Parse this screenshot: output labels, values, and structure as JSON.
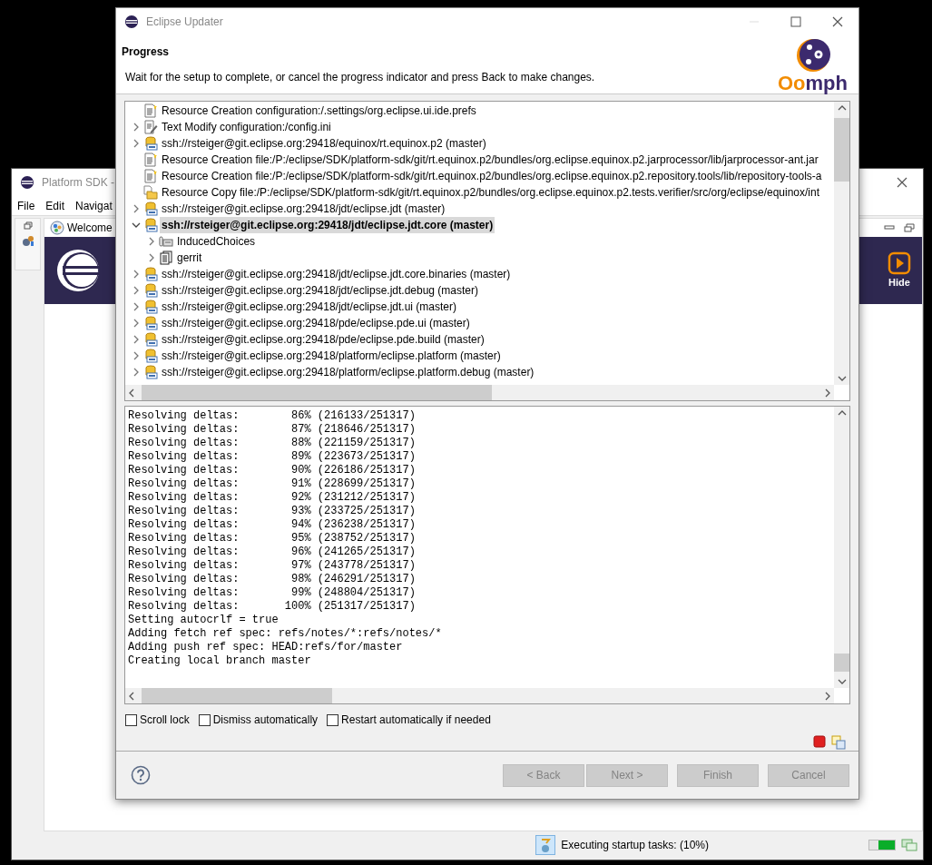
{
  "background_window": {
    "title": "Platform SDK -",
    "menu": [
      "File",
      "Edit",
      "Navigat"
    ],
    "editor_tab": {
      "label": "Welcome",
      "selected": true
    },
    "banner": {
      "hide_button": "Hide"
    },
    "status_bar": {
      "message": "Executing startup tasks: (10%)",
      "heap": {
        "level": 0.65
      }
    }
  },
  "dialog": {
    "title": "Eclipse Updater",
    "heading": "Progress",
    "description": "Wait for the setup to complete, or cancel the progress indicator and press Back to make changes.",
    "logo_text": "Oomph",
    "tasks": [
      {
        "kind": "creation",
        "selected": false,
        "label": "Resource Creation configuration:/.settings/org.eclipse.ui.ide.prefs"
      },
      {
        "kind": "modify",
        "expanded": false,
        "selected": false,
        "label": "Text Modify configuration:/config.ini"
      },
      {
        "kind": "git",
        "expanded": false,
        "selected": false,
        "label": "ssh://rsteiger@git.eclipse.org:29418/equinox/rt.equinox.p2  (master)"
      },
      {
        "kind": "creation",
        "selected": false,
        "label": "Resource Creation file:/P:/eclipse/SDK/platform-sdk/git/rt.equinox.p2/bundles/org.eclipse.equinox.p2.jarprocessor/lib/jarprocessor-ant.jar"
      },
      {
        "kind": "creation",
        "selected": false,
        "label": "Resource Creation file:/P:/eclipse/SDK/platform-sdk/git/rt.equinox.p2/bundles/org.eclipse.equinox.p2.repository.tools/lib/repository-tools-a"
      },
      {
        "kind": "copy",
        "selected": false,
        "label": "Resource Copy file:/P:/eclipse/SDK/platform-sdk/git/rt.equinox.p2/bundles/org.eclipse.equinox.p2.tests.verifier/src/org/eclipse/equinox/int"
      },
      {
        "kind": "git",
        "expanded": false,
        "selected": false,
        "label": "ssh://rsteiger@git.eclipse.org:29418/jdt/eclipse.jdt  (master)"
      },
      {
        "kind": "git",
        "expanded": true,
        "selected": true,
        "label": "ssh://rsteiger@git.eclipse.org:29418/jdt/eclipse.jdt.core  (master)",
        "children": [
          {
            "kind": "choices",
            "expanded": false,
            "selected": false,
            "label": "InducedChoices"
          },
          {
            "kind": "gerrit",
            "expanded": false,
            "selected": false,
            "label": "gerrit"
          }
        ]
      },
      {
        "kind": "git",
        "expanded": false,
        "selected": false,
        "label": "ssh://rsteiger@git.eclipse.org:29418/jdt/eclipse.jdt.core.binaries  (master)"
      },
      {
        "kind": "git",
        "expanded": false,
        "selected": false,
        "label": "ssh://rsteiger@git.eclipse.org:29418/jdt/eclipse.jdt.debug  (master)"
      },
      {
        "kind": "git",
        "expanded": false,
        "selected": false,
        "label": "ssh://rsteiger@git.eclipse.org:29418/jdt/eclipse.jdt.ui  (master)"
      },
      {
        "kind": "git",
        "expanded": false,
        "selected": false,
        "label": "ssh://rsteiger@git.eclipse.org:29418/pde/eclipse.pde.ui  (master)"
      },
      {
        "kind": "git",
        "expanded": false,
        "selected": false,
        "label": "ssh://rsteiger@git.eclipse.org:29418/pde/eclipse.pde.build  (master)"
      },
      {
        "kind": "git",
        "expanded": false,
        "selected": false,
        "label": "ssh://rsteiger@git.eclipse.org:29418/platform/eclipse.platform  (master)"
      },
      {
        "kind": "git",
        "expanded": false,
        "selected": false,
        "label": "ssh://rsteiger@git.eclipse.org:29418/platform/eclipse.platform.debug  (master)"
      }
    ],
    "log": [
      "Resolving deltas:        86% (216133/251317)",
      "Resolving deltas:        87% (218646/251317)",
      "Resolving deltas:        88% (221159/251317)",
      "Resolving deltas:        89% (223673/251317)",
      "Resolving deltas:        90% (226186/251317)",
      "Resolving deltas:        91% (228699/251317)",
      "Resolving deltas:        92% (231212/251317)",
      "Resolving deltas:        93% (233725/251317)",
      "Resolving deltas:        94% (236238/251317)",
      "Resolving deltas:        95% (238752/251317)",
      "Resolving deltas:        96% (241265/251317)",
      "Resolving deltas:        97% (243778/251317)",
      "Resolving deltas:        98% (246291/251317)",
      "Resolving deltas:        99% (248804/251317)",
      "Resolving deltas:       100% (251317/251317)",
      "Setting autocrlf = true",
      "Adding fetch ref spec: refs/notes/*:refs/notes/*",
      "Adding push ref spec: HEAD:refs/for/master",
      "Creating local branch master"
    ],
    "options": [
      {
        "label": "Scroll lock",
        "checked": false
      },
      {
        "label": "Dismiss automatically",
        "checked": false
      },
      {
        "label": "Restart automatically if needed",
        "checked": false
      }
    ],
    "buttons": [
      {
        "label": "< Back",
        "disabled": true
      },
      {
        "label": "Next >",
        "disabled": true
      },
      {
        "label": "Finish",
        "disabled": true
      },
      {
        "label": "Cancel",
        "disabled": true
      }
    ]
  }
}
